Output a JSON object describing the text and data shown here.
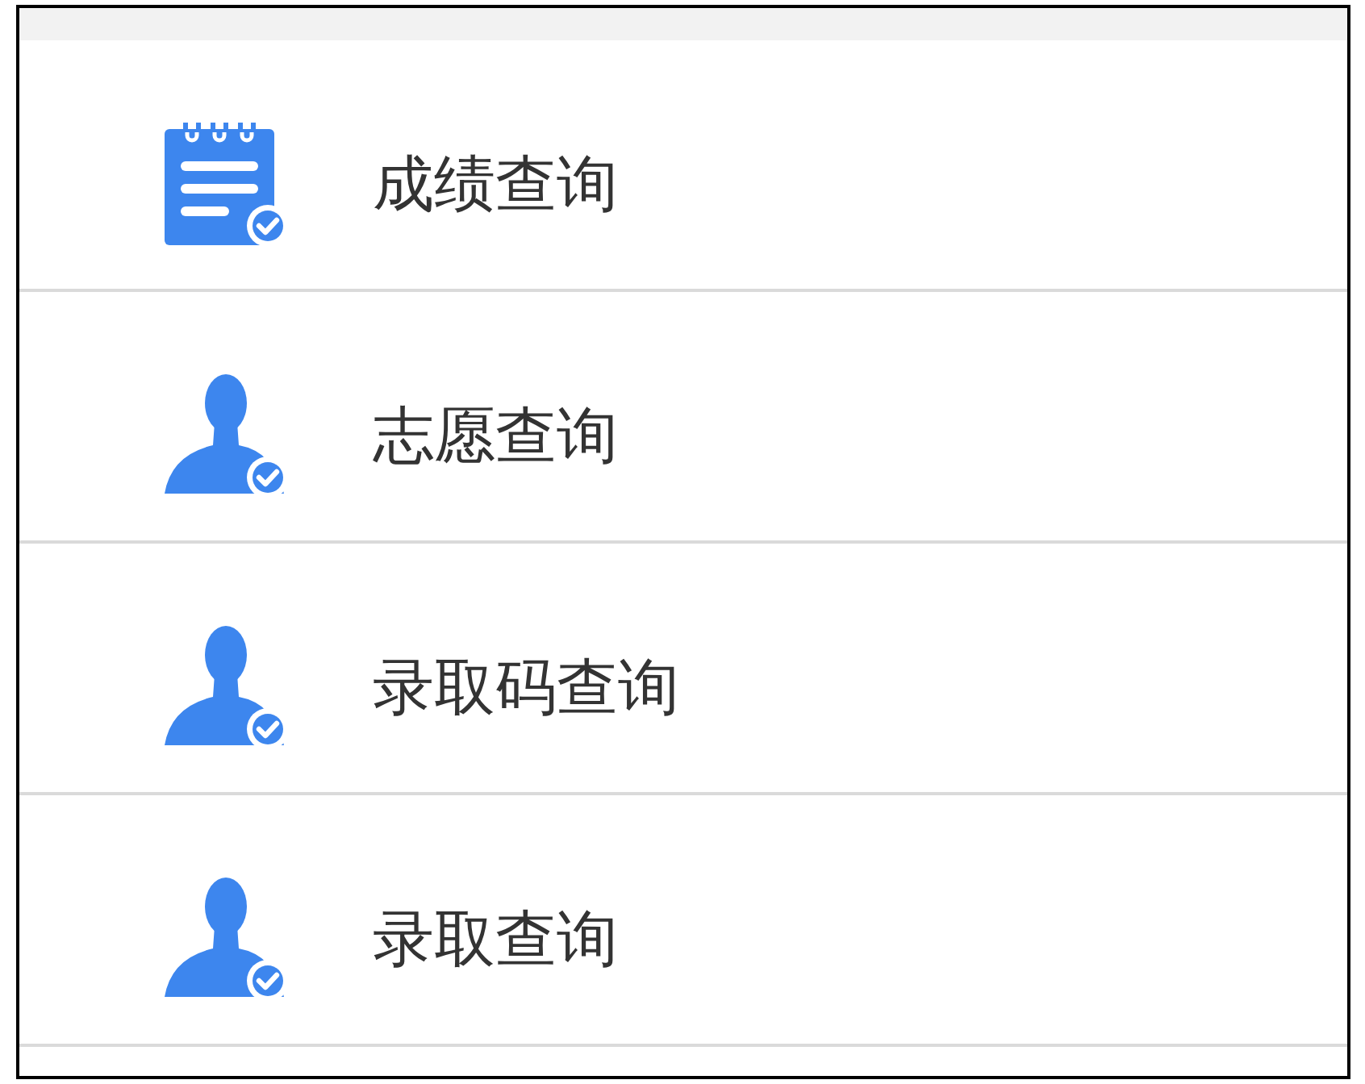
{
  "menu": {
    "items": [
      {
        "kind": "notepad",
        "label": "成绩查询"
      },
      {
        "kind": "person",
        "label": "志愿查询"
      },
      {
        "kind": "person",
        "label": "录取码查询"
      },
      {
        "kind": "person",
        "label": "录取查询"
      }
    ]
  }
}
